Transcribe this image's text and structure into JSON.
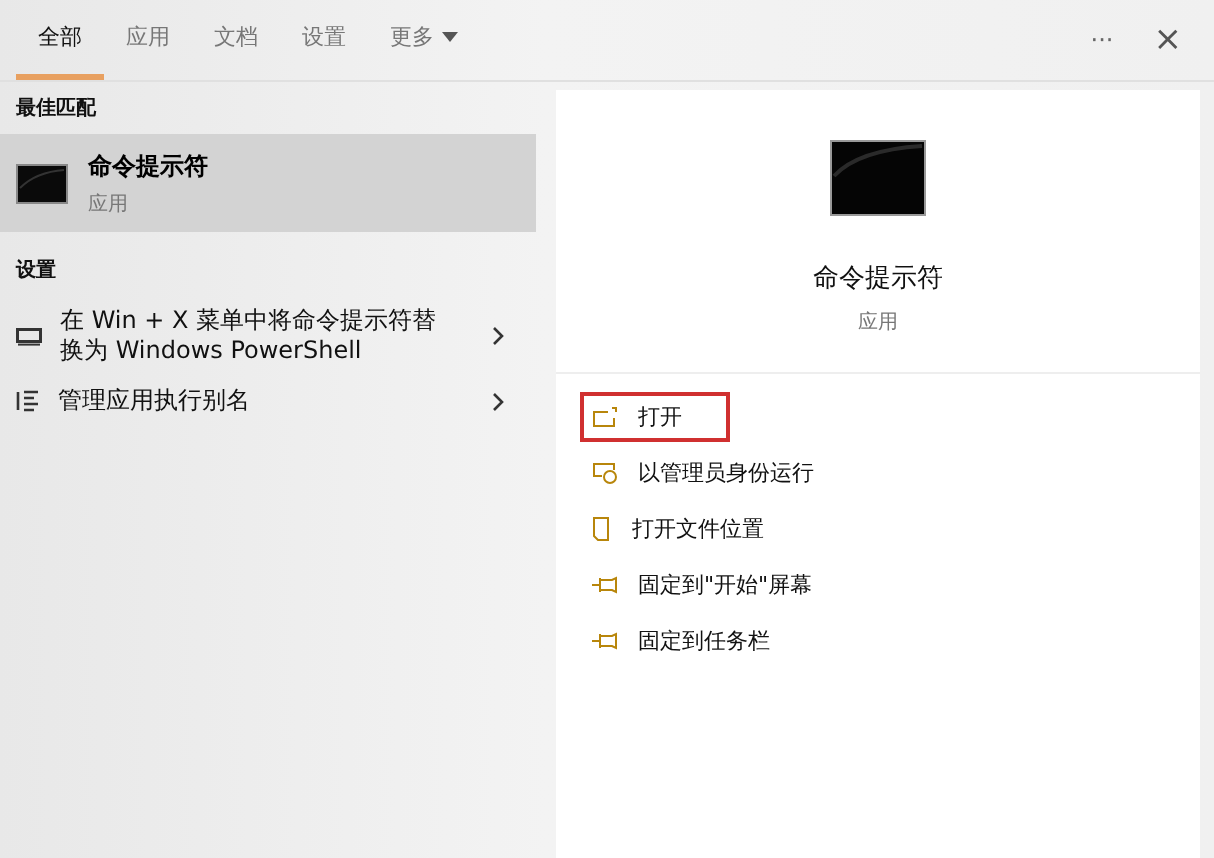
{
  "tabs": [
    {
      "label": "全部",
      "selected": true
    },
    {
      "label": "应用",
      "selected": false
    },
    {
      "label": "文档",
      "selected": false
    },
    {
      "label": "设置",
      "selected": false
    },
    {
      "label": "更多",
      "selected": false,
      "dropdown": true
    }
  ],
  "top_actions": {
    "more": "···",
    "close": "×"
  },
  "best_match": {
    "heading": "最佳匹配",
    "title": "命令提示符",
    "subtitle": "应用",
    "selected": true
  },
  "settings": {
    "heading": "设置",
    "items": [
      {
        "kind": "display",
        "label": "在 Win + X 菜单中将命令提示符替换为 Windows PowerShell"
      },
      {
        "kind": "list",
        "label": "管理应用执行别名"
      }
    ]
  },
  "detail": {
    "title": "命令提示符",
    "subtitle": "应用",
    "actions": [
      {
        "kind": "open",
        "label": "打开",
        "highlighted": true
      },
      {
        "kind": "admin",
        "label": "以管理员身份运行",
        "highlighted": false
      },
      {
        "kind": "folder",
        "label": "打开文件位置",
        "highlighted": false
      },
      {
        "kind": "pin",
        "label": "固定到\"开始\"屏幕",
        "highlighted": false
      },
      {
        "kind": "pin",
        "label": "固定到任务栏",
        "highlighted": false
      }
    ]
  }
}
